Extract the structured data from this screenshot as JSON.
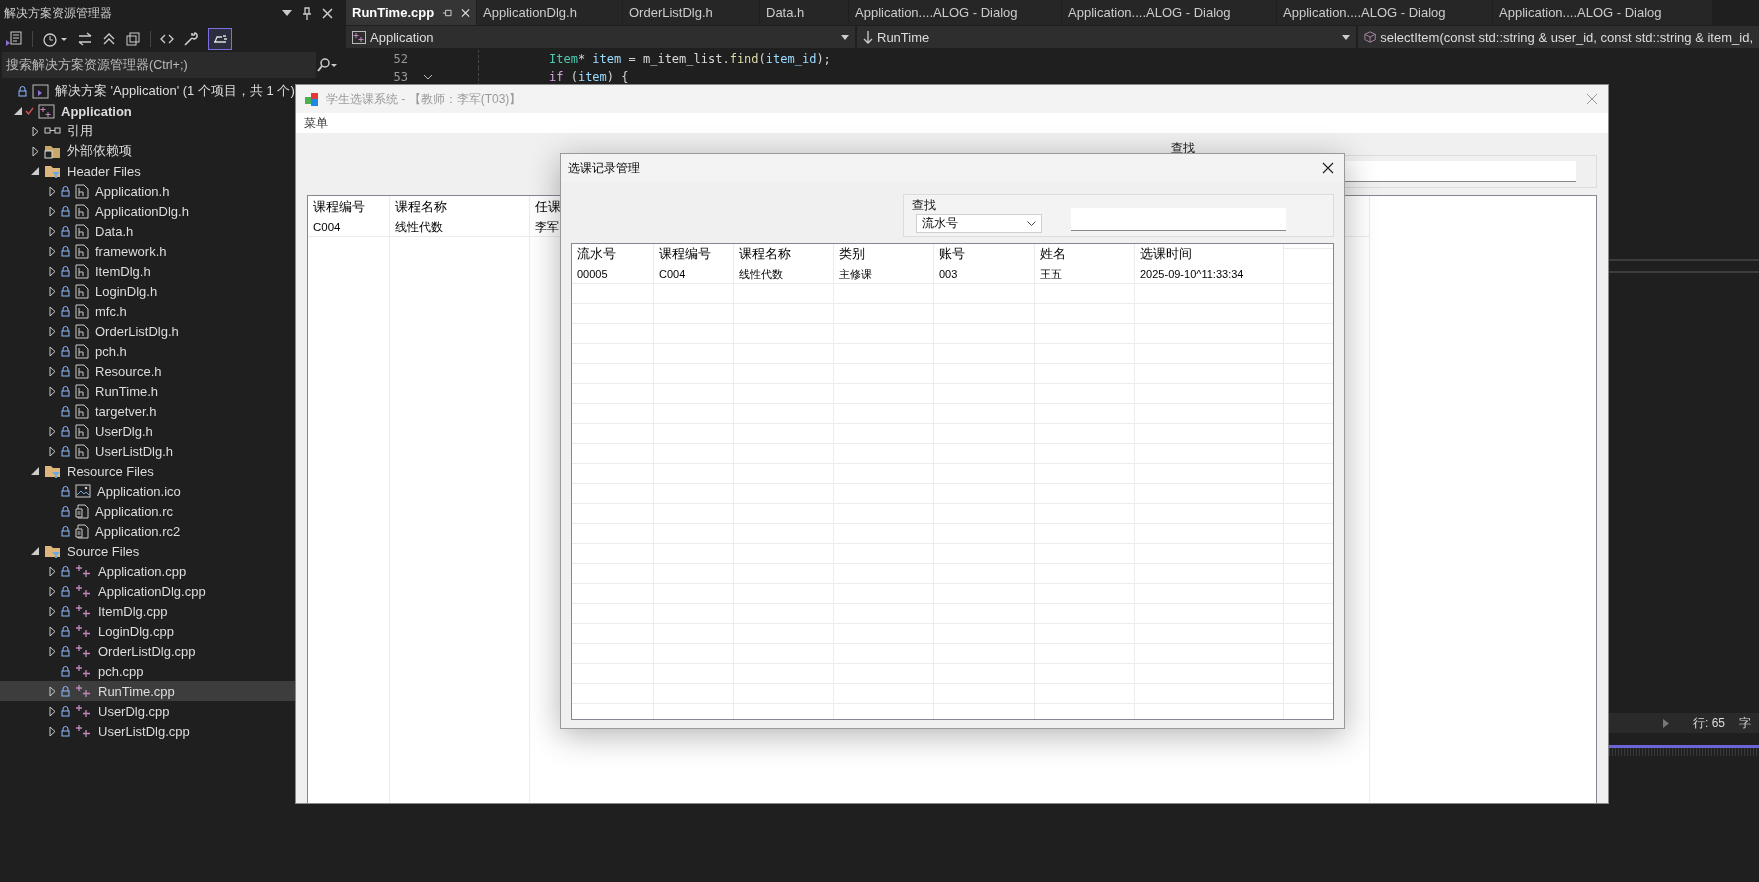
{
  "explorer": {
    "title": "解决方案资源管理器",
    "search": {
      "placeholder": "搜索解决方案资源管理器(Ctrl+;)"
    },
    "tree": [
      {
        "kind": "solution",
        "label": "解决方案 'Application' (1 个项目，共 1 个)",
        "selected": false,
        "children": [
          {
            "kind": "project",
            "label": "Application",
            "expanded": true,
            "selected": false,
            "children": [
              {
                "kind": "reference",
                "label": "引用",
                "expanded": false,
                "selected": false
              },
              {
                "kind": "external",
                "label": "外部依赖项",
                "expanded": false,
                "selected": false
              },
              {
                "kind": "filter",
                "label": "Header Files",
                "expanded": true,
                "selected": false,
                "children": [
                  {
                    "kind": "header",
                    "label": "Application.h",
                    "expanded": false,
                    "selected": false
                  },
                  {
                    "kind": "header",
                    "label": "ApplicationDlg.h",
                    "expanded": false,
                    "selected": false
                  },
                  {
                    "kind": "header",
                    "label": "Data.h",
                    "expanded": false,
                    "selected": false
                  },
                  {
                    "kind": "header",
                    "label": "framework.h",
                    "expanded": false,
                    "selected": false
                  },
                  {
                    "kind": "header",
                    "label": "ItemDlg.h",
                    "expanded": false,
                    "selected": false
                  },
                  {
                    "kind": "header",
                    "label": "LoginDlg.h",
                    "expanded": false,
                    "selected": false
                  },
                  {
                    "kind": "header",
                    "label": "mfc.h",
                    "expanded": false,
                    "selected": false
                  },
                  {
                    "kind": "header",
                    "label": "OrderListDlg.h",
                    "expanded": false,
                    "selected": false
                  },
                  {
                    "kind": "header",
                    "label": "pch.h",
                    "expanded": false,
                    "selected": false
                  },
                  {
                    "kind": "header",
                    "label": "Resource.h",
                    "expanded": false,
                    "selected": false
                  },
                  {
                    "kind": "header",
                    "label": "RunTime.h",
                    "expanded": false,
                    "selected": false
                  },
                  {
                    "kind": "header",
                    "label": "targetver.h",
                    "selected": false
                  },
                  {
                    "kind": "header",
                    "label": "UserDlg.h",
                    "expanded": false,
                    "selected": false
                  },
                  {
                    "kind": "header",
                    "label": "UserListDlg.h",
                    "expanded": false,
                    "selected": false
                  }
                ]
              },
              {
                "kind": "filter",
                "label": "Resource Files",
                "expanded": true,
                "selected": false,
                "children": [
                  {
                    "kind": "resource-ico",
                    "label": "Application.ico",
                    "selected": false
                  },
                  {
                    "kind": "resource-rc",
                    "label": "Application.rc",
                    "selected": false
                  },
                  {
                    "kind": "resource-rc",
                    "label": "Application.rc2",
                    "selected": false
                  }
                ]
              },
              {
                "kind": "filter",
                "label": "Source Files",
                "expanded": true,
                "selected": false,
                "children": [
                  {
                    "kind": "source",
                    "label": "Application.cpp",
                    "expanded": false,
                    "selected": false
                  },
                  {
                    "kind": "source",
                    "label": "ApplicationDlg.cpp",
                    "expanded": false,
                    "selected": false
                  },
                  {
                    "kind": "source",
                    "label": "ItemDlg.cpp",
                    "expanded": false,
                    "selected": false
                  },
                  {
                    "kind": "source",
                    "label": "LoginDlg.cpp",
                    "expanded": false,
                    "selected": false
                  },
                  {
                    "kind": "source",
                    "label": "OrderListDlg.cpp",
                    "expanded": false,
                    "selected": false
                  },
                  {
                    "kind": "source",
                    "label": "pch.cpp",
                    "selected": false
                  },
                  {
                    "kind": "source",
                    "label": "RunTime.cpp",
                    "expanded": false,
                    "selected": true
                  },
                  {
                    "kind": "source",
                    "label": "UserDlg.cpp",
                    "expanded": false,
                    "selected": false
                  },
                  {
                    "kind": "source",
                    "label": "UserListDlg.cpp",
                    "expanded": false,
                    "selected": false
                  }
                ]
              }
            ]
          }
        ]
      }
    ]
  },
  "editor": {
    "tabs": [
      {
        "label": "RunTime.cpp",
        "selected": true
      },
      {
        "label": "ApplicationDlg.h",
        "selected": false
      },
      {
        "label": "OrderListDlg.h",
        "selected": false
      },
      {
        "label": "Data.h",
        "selected": false
      },
      {
        "label": "Application....ALOG - Dialog",
        "selected": false
      },
      {
        "label": "Application....ALOG - Dialog",
        "selected": false
      },
      {
        "label": "Application....ALOG - Dialog",
        "selected": false
      },
      {
        "label": "Application....ALOG - Dialog",
        "selected": false
      }
    ],
    "nav": {
      "project": "Application",
      "class": "RunTime",
      "member": "selectItem(const std::string & user_id, const std::string & item_id,"
    },
    "lines": [
      {
        "number": "52",
        "fold": false,
        "tokens": [
          {
            "text": "Item",
            "kind": "type"
          },
          {
            "text": "* ",
            "kind": "plain"
          },
          {
            "text": "item",
            "kind": "var"
          },
          {
            "text": " = ",
            "kind": "plain"
          },
          {
            "text": "m_item_list",
            "kind": "member"
          },
          {
            "text": ".",
            "kind": "plain"
          },
          {
            "text": "find",
            "kind": "func"
          },
          {
            "text": "(",
            "kind": "plain"
          },
          {
            "text": "item_id",
            "kind": "var"
          },
          {
            "text": ");",
            "kind": "plain"
          }
        ]
      },
      {
        "number": "53",
        "fold": true,
        "tokens": [
          {
            "text": "if",
            "kind": "keyword"
          },
          {
            "text": " (",
            "kind": "plain"
          },
          {
            "text": "item",
            "kind": "var"
          },
          {
            "text": ") {",
            "kind": "plain"
          }
        ]
      }
    ]
  },
  "status": {
    "line": "行: 65",
    "column": "字"
  },
  "app": {
    "title": "学生选课系统 - 【教师：李军(T03)】",
    "menu": [
      "菜单"
    ],
    "search_label": "查找",
    "table": {
      "columns": [
        "课程编号",
        "课程名称",
        "任课"
      ],
      "rows": [
        [
          "C004",
          "线性代数",
          "李军"
        ]
      ]
    }
  },
  "dialog": {
    "title": "选课记录管理",
    "group": "查找",
    "search_by": "流水号",
    "columns": [
      "流水号",
      "课程编号",
      "课程名称",
      "类别",
      "账号",
      "姓名",
      "选课时间"
    ],
    "rows": [
      [
        "00005",
        "C004",
        "线性代数",
        "主修课",
        "003",
        "王五",
        "2025-09-10^11:33:34"
      ]
    ]
  }
}
